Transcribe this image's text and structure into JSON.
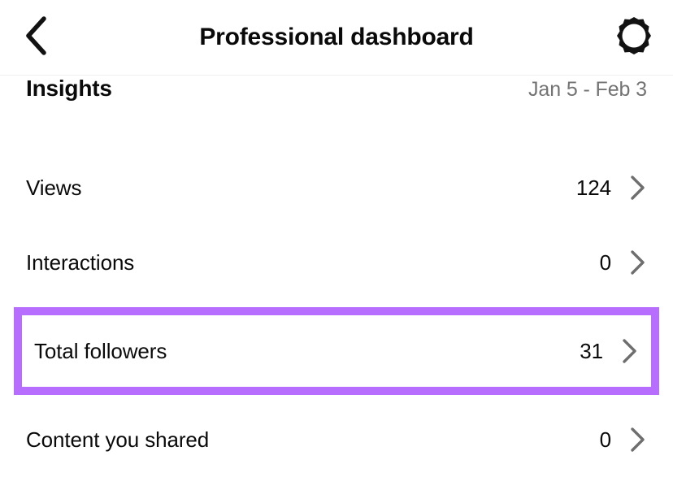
{
  "header": {
    "title": "Professional dashboard",
    "back_icon": "chevron-left-icon",
    "settings_icon": "gear-icon"
  },
  "insights": {
    "title": "Insights",
    "date_range": "Jan 5 - Feb 3"
  },
  "rows": [
    {
      "label": "Views",
      "value": "124",
      "chevron": "chevron-right-icon",
      "highlighted": false
    },
    {
      "label": "Interactions",
      "value": "0",
      "chevron": "chevron-right-icon",
      "highlighted": false
    },
    {
      "label": "Total followers",
      "value": "31",
      "chevron": "chevron-right-icon",
      "highlighted": true
    },
    {
      "label": "Content you shared",
      "value": "0",
      "chevron": "chevron-right-icon",
      "highlighted": false
    }
  ],
  "colors": {
    "highlight": "#b76eff",
    "text_primary": "#0a0a0a",
    "text_secondary": "#737373",
    "divider": "#efefef",
    "background": "#ffffff"
  }
}
